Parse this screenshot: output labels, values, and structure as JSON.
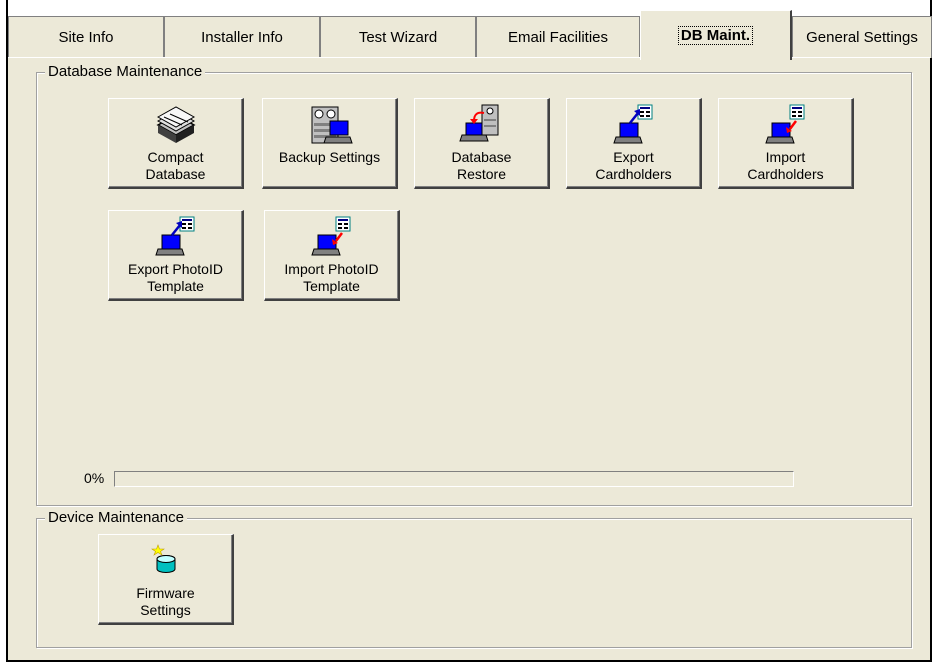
{
  "tabs": [
    {
      "label": "Site Info",
      "active": false
    },
    {
      "label": "Installer Info",
      "active": false
    },
    {
      "label": "Test Wizard",
      "active": false
    },
    {
      "label": "Email Facilities",
      "active": false
    },
    {
      "label": "DB Maint.",
      "active": true
    },
    {
      "label": "General Settings",
      "active": false
    }
  ],
  "database_group": {
    "title": "Database Maintenance",
    "buttons": [
      {
        "label": "Compact\nDatabase",
        "icon": "compact-database-icon"
      },
      {
        "label": "Backup Settings",
        "icon": "backup-settings-icon"
      },
      {
        "label": "Database\nRestore",
        "icon": "database-restore-icon"
      },
      {
        "label": "Export\nCardholders",
        "icon": "export-cardholders-icon"
      },
      {
        "label": "Import\nCardholders",
        "icon": "import-cardholders-icon"
      },
      {
        "label": "Export PhotoID\nTemplate",
        "icon": "export-photoid-template-icon"
      },
      {
        "label": "Import PhotoID\nTemplate",
        "icon": "import-photoid-template-icon"
      }
    ],
    "progress": {
      "label": "0%",
      "value": 0
    }
  },
  "device_group": {
    "title": "Device Maintenance",
    "buttons": [
      {
        "label": "Firmware\nSettings",
        "icon": "firmware-settings-icon"
      }
    ]
  },
  "colors": {
    "face": "#ece9d8",
    "screen_blue": "#0000ff",
    "arrow_blue": "#0000c0",
    "arrow_red": "#ff0000",
    "progress_fill": "#0a246a"
  }
}
